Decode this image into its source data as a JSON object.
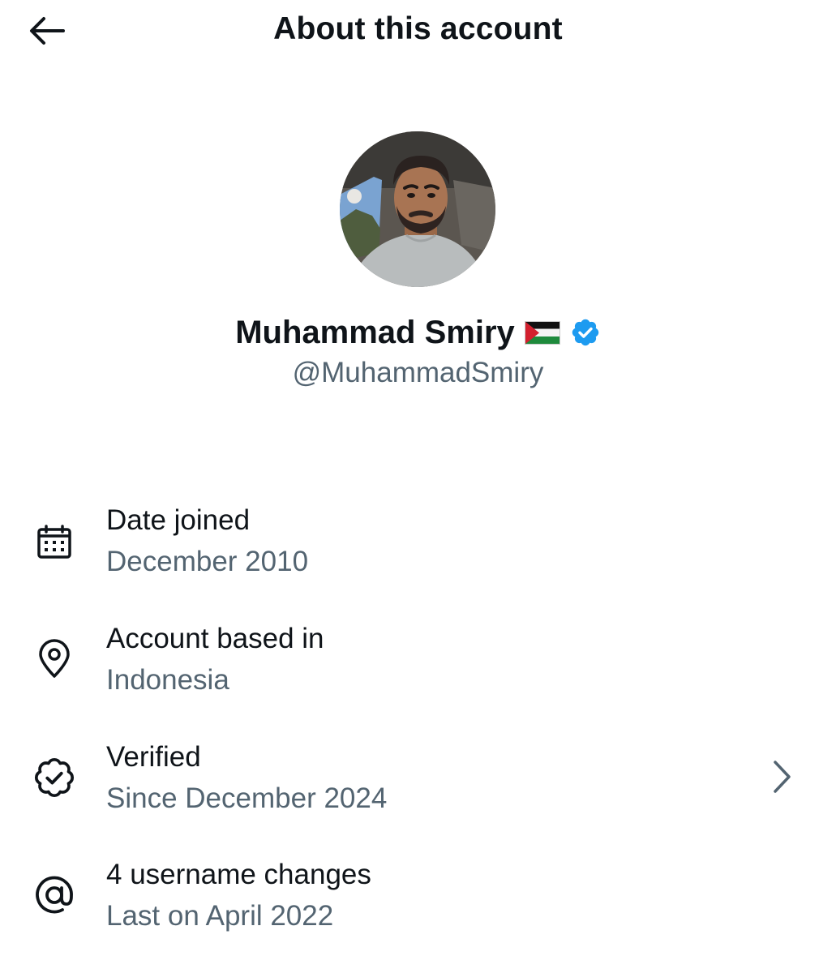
{
  "header": {
    "title": "About this account",
    "back_icon": "arrow-left-icon"
  },
  "profile": {
    "display_name": "Muhammad Smiry",
    "flag_icon": "palestine-flag-icon",
    "verified_icon": "verified-badge-icon",
    "verified_color": "#1d9bf0",
    "handle": "@MuhammadSmiry"
  },
  "info": {
    "date_joined": {
      "label": "Date joined",
      "value": "December 2010",
      "icon": "calendar-icon"
    },
    "location": {
      "label": "Account based in",
      "value": "Indonesia",
      "icon": "location-pin-icon"
    },
    "verified": {
      "label": "Verified",
      "value": "Since December 2024",
      "icon": "verified-outline-icon",
      "chevron_icon": "chevron-right-icon"
    },
    "username_changes": {
      "label": "4 username changes",
      "value": "Last on April 2022",
      "icon": "at-sign-icon"
    }
  },
  "colors": {
    "text_primary": "#0f1419",
    "text_secondary": "#536471",
    "background": "#ffffff"
  }
}
